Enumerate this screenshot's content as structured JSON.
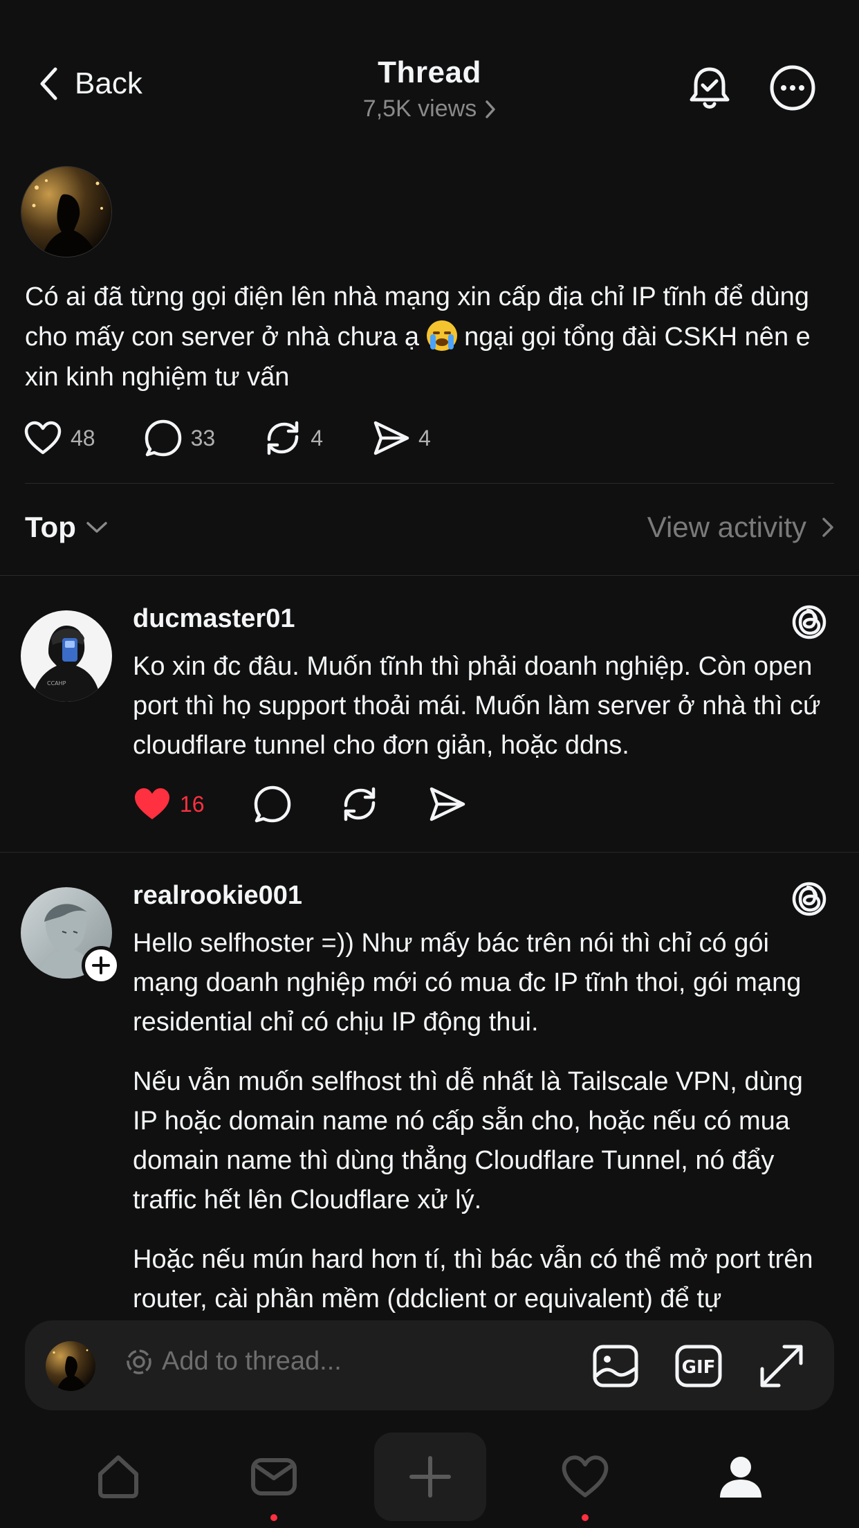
{
  "header": {
    "back_label": "Back",
    "title": "Thread",
    "views": "7,5K views"
  },
  "post": {
    "text_before_emoji": "Có ai đã từng gọi điện lên nhà mạng xin cấp địa chỉ IP tĩnh để dùng cho mấy con server ở nhà chưa ạ ",
    "emoji": "loudly-crying-face",
    "text_after_emoji": " ngại gọi tổng đài CSKH nên e xin kinh nghiệm tư vấn",
    "likes": "48",
    "comments": "33",
    "reposts": "4",
    "shares": "4"
  },
  "sort": {
    "label": "Top",
    "view_activity": "View activity"
  },
  "replies": [
    {
      "username": "ducmaster01",
      "paragraphs": [
        "Ko xin đc đâu. Muốn tĩnh thì phải doanh nghiệp. Còn open port thì họ support thoải mái. Muốn làm server ở nhà thì cứ cloudflare tunnel cho đơn giản, hoặc ddns."
      ],
      "likes": "16",
      "liked": true
    },
    {
      "username": "realrookie001",
      "paragraphs": [
        "Hello selfhoster =)) Như mấy bác trên nói thì chỉ có gói mạng doanh nghiệp mới có mua đc IP tĩnh thoi, gói mạng residential chỉ có chịu IP động thui.",
        "Nếu vẫn muốn selfhost thì dễ nhất là Tailscale VPN, dùng IP hoặc domain name nó cấp sẵn cho, hoặc nếu có mua domain name thì dùng thẳng Cloudflare Tunnel, nó đẩy traffic hết lên Cloudflare xử lý.",
        "Hoặc nếu mún hard hơn tí, thì bác vẫn có thể mở port trên router, cài phần mềm (ddclient or equivalent) để tự"
      ]
    }
  ],
  "composer": {
    "placeholder": "Add to thread..."
  },
  "tabs": [
    "home",
    "messages",
    "new-post",
    "activity",
    "profile"
  ],
  "colors": {
    "background": "#101010",
    "text": "#f3f5f7",
    "muted": "#8a8a8a",
    "like_red": "#ff3040",
    "surface": "#1e1e1e"
  }
}
